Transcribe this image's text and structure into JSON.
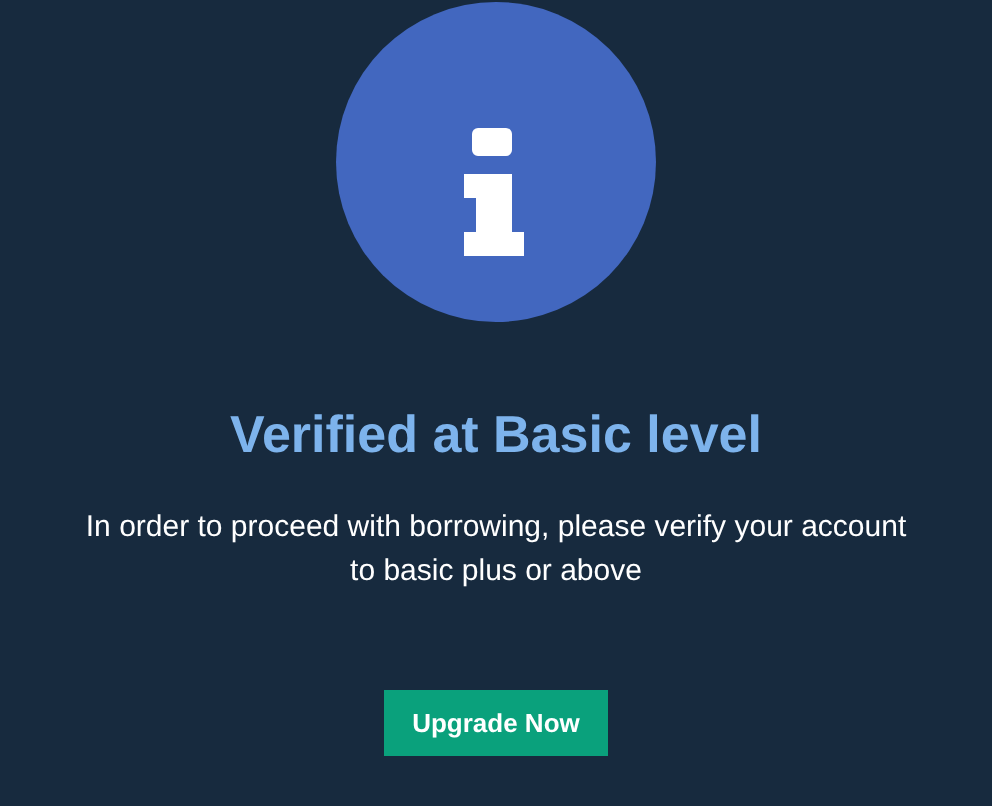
{
  "title": "Verified at Basic level",
  "message": "In order to proceed with borrowing, please verify your account to basic plus or above",
  "button": {
    "label": "Upgrade Now"
  }
}
